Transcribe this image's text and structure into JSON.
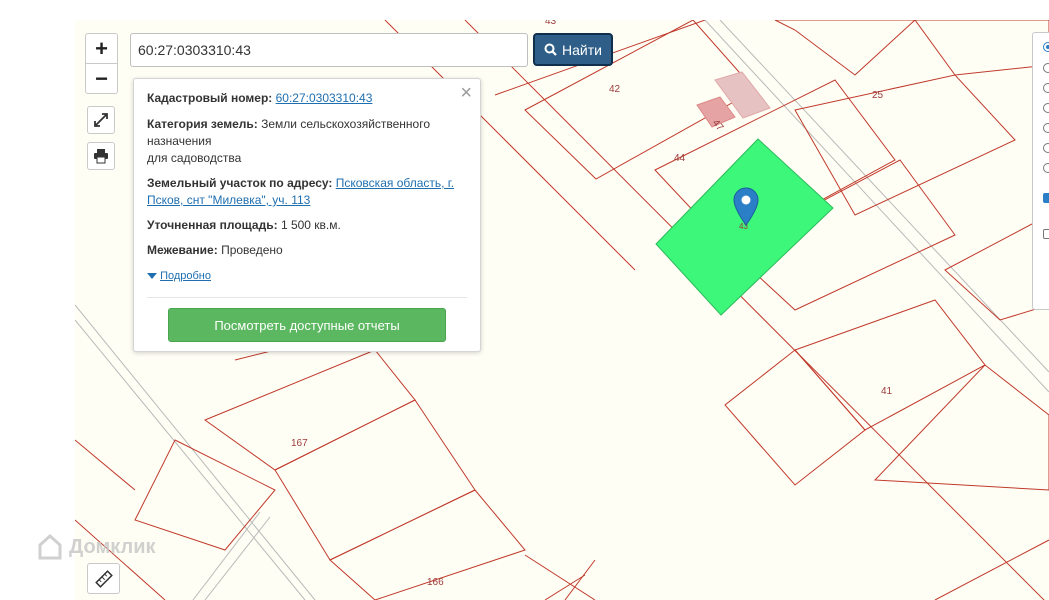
{
  "search": {
    "value": "60:27:0303310:43",
    "button_label": "Найти"
  },
  "zoom": {
    "in_label": "+",
    "out_label": "−"
  },
  "popup": {
    "cadastral_label": "Кадастровый номер:",
    "cadastral_value": "60:27:0303310:43",
    "category_label": "Категория земель:",
    "category_value_line1": "Земли сельскохозяйственного",
    "category_value_line2": "назначения",
    "category_value_line3": "для садоводства",
    "address_label": "Земельный участок по адресу:",
    "address_value_line1": "Псковская область, г.",
    "address_value_line2": "Псков, снт \"Милевка\", уч. 113",
    "area_label": "Уточненная площадь:",
    "area_value": "1 500 кв.м.",
    "survey_label": "Межевание:",
    "survey_value": "Проведено",
    "details_link": "Подробно",
    "reports_button": "Посмотреть доступные отчеты",
    "close": "×"
  },
  "parcels": {
    "p43_top": "43",
    "p42": "42",
    "p47": "47",
    "p25": "25",
    "p44": "44",
    "p43_selected": "43",
    "p41": "41",
    "p167": "167",
    "p166": "166"
  },
  "watermark": "Домклик",
  "colors": {
    "selected_parcel": "#3cf77a",
    "parcel_border": "#c0392b",
    "search_button": "#2f5f88",
    "reports_button": "#5cb860",
    "link": "#1f6fb0",
    "marker": "#2a7fc7"
  },
  "icons": [
    "fullscreen-icon",
    "print-icon",
    "ruler-icon",
    "search-icon",
    "map-marker-icon",
    "caret-down-icon"
  ]
}
